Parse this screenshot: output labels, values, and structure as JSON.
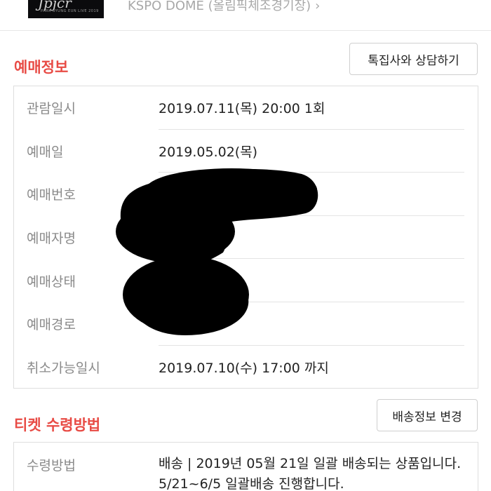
{
  "header": {
    "poster_title": "Jpjcr",
    "poster_caption": "PARK BYUNG EUN LIVE 2019",
    "venue": "KSPO DOME (올림픽체조경기장)",
    "venue_chevron": "›"
  },
  "booking_info": {
    "title": "예매정보",
    "contact_button": "톡집사와 상담하기",
    "rows": [
      {
        "label": "관람일시",
        "value": "2019.07.11(목) 20:00 1회"
      },
      {
        "label": "예매일",
        "value": "2019.05.02(목)"
      },
      {
        "label": "예매번호",
        "value": ""
      },
      {
        "label": "예매자명",
        "value": ""
      },
      {
        "label": "예매상태",
        "value": ""
      },
      {
        "label": "예매경로",
        "value": ""
      },
      {
        "label": "취소가능일시",
        "value": "2019.07.10(수) 17:00 까지"
      }
    ]
  },
  "ticket_receipt": {
    "title": "티켓 수령방법",
    "change_button": "배송정보 변경",
    "method_label": "수령방법",
    "method_value": "배송 | 2019년 05월 21일 일괄 배송되는 상품입니다. 5/21~6/5 일괄배송 진행합니다."
  },
  "colors": {
    "accent": "#e84b45",
    "label_gray": "#8a8a8a",
    "border": "#dedede",
    "redaction": "#000000"
  }
}
